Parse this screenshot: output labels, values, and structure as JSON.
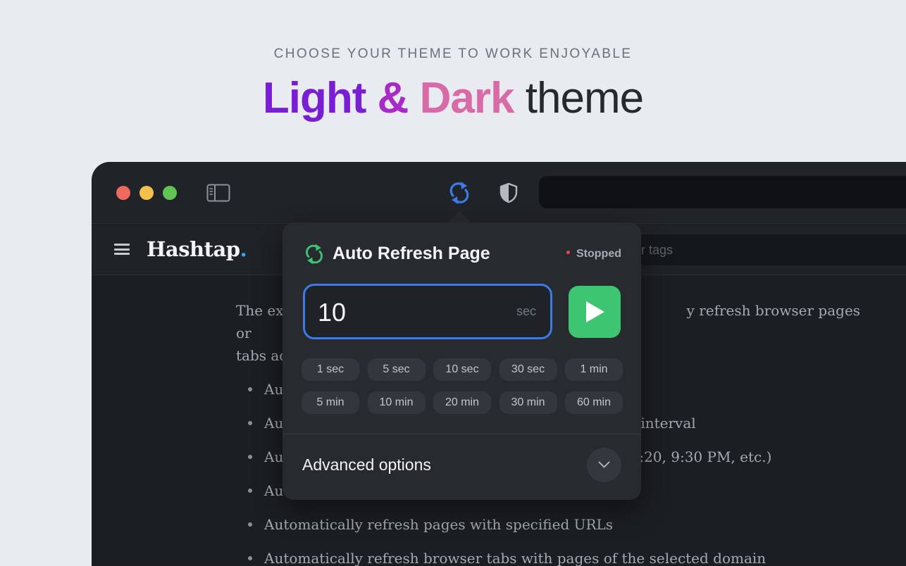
{
  "hero": {
    "subtitle": "CHOOSE YOUR THEME TO WORK ENJOYABLE",
    "title_light": "Light",
    "title_amp": "&",
    "title_dark": "Dark",
    "title_theme": "theme"
  },
  "toolbar": {
    "icons": [
      "sidebar-toggle-icon",
      "refresh-extension-icon",
      "shield-icon"
    ]
  },
  "site": {
    "logo": "Hashtap",
    "logo_dot": ".",
    "search_placeholder_visible": "or tags"
  },
  "article": {
    "intro_line1": "The ex",
    "intro_right1": "y refresh browser pages or",
    "intro_line2": "tabs ac",
    "bullets": [
      {
        "left": "Au",
        "right": ""
      },
      {
        "left": "Au",
        "right": "interval"
      },
      {
        "left": "Au",
        "right": ":20, 9:30 PM, etc.)"
      },
      {
        "left": "Au",
        "right": ""
      },
      {
        "left": "Automatically refresh pages with specified URLs",
        "right": ""
      },
      {
        "left": "Automatically refresh browser tabs with pages of the selected domain",
        "right": ""
      }
    ]
  },
  "popup": {
    "title": "Auto Refresh Page",
    "status": "Stopped",
    "interval_value": "10",
    "interval_unit": "sec",
    "presets_row1": [
      "1 sec",
      "5 sec",
      "10 sec",
      "30 sec",
      "1 min"
    ],
    "presets_row2": [
      "5 min",
      "10 min",
      "20 min",
      "30 min",
      "60 min"
    ],
    "advanced_label": "Advanced options"
  },
  "colors": {
    "accent_blue": "#3b7ae8",
    "play_green": "#3ec571",
    "status_red": "#e5484d",
    "refresh_icon_green": "#3ec571"
  }
}
